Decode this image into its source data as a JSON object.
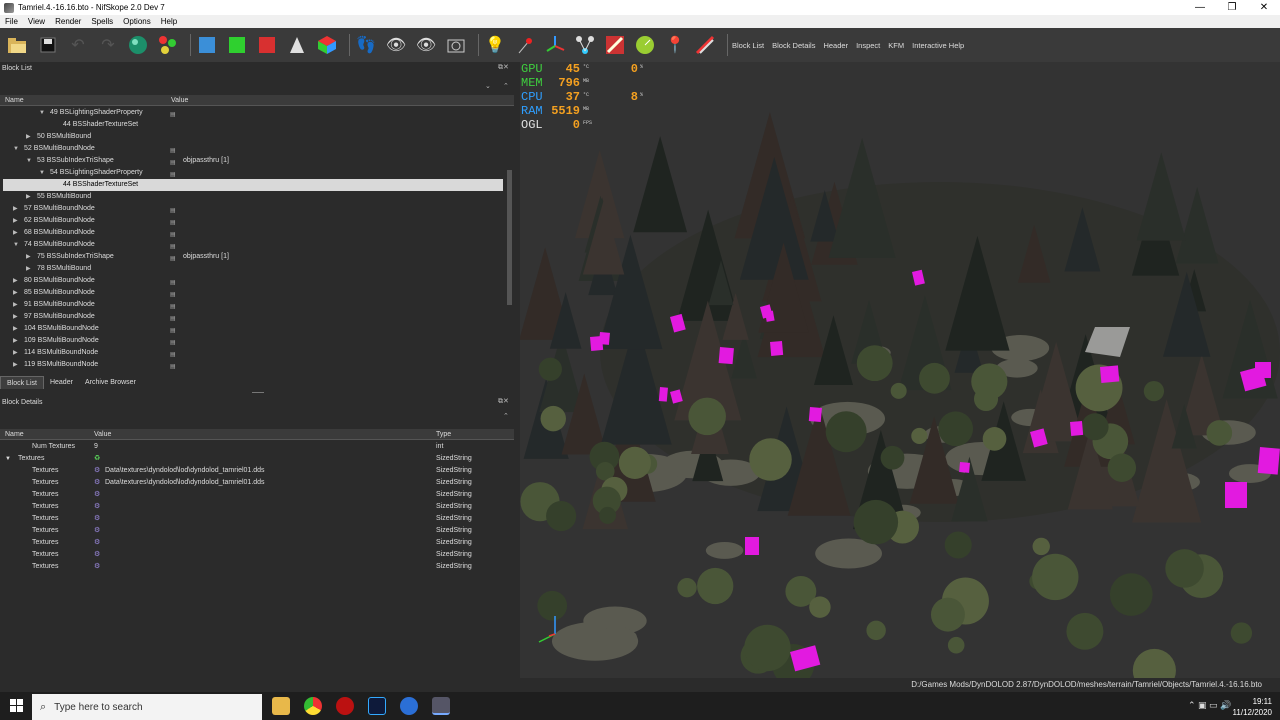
{
  "window": {
    "title": "Tamriel.4.-16.16.bto - NifSkope 2.0 Dev 7",
    "minimize": "—",
    "restore": "❐",
    "close": "✕"
  },
  "menu": [
    "File",
    "View",
    "Render",
    "Spells",
    "Options",
    "Help"
  ],
  "toolbar": {
    "links": [
      "Block List",
      "Block Details",
      "Header",
      "Inspect",
      "KFM",
      "Interactive Help"
    ]
  },
  "block_list": {
    "title": "Block List",
    "col_name": "Name",
    "col_value": "Value",
    "rows": [
      {
        "label": "49 BSLightingShaderProperty",
        "value": "",
        "indent": 3,
        "arrow": "▼",
        "icon": true
      },
      {
        "label": "44 BSShaderTextureSet",
        "value": "",
        "indent": 4,
        "arrow": "",
        "icon": false
      },
      {
        "label": "50 BSMultiBound",
        "value": "",
        "indent": 2,
        "arrow": "▶",
        "icon": false
      },
      {
        "label": "52 BSMultiBoundNode",
        "value": "",
        "indent": 1,
        "arrow": "▼",
        "icon": true
      },
      {
        "label": "53 BSSubIndexTriShape",
        "value": "objpassthru [1]",
        "indent": 2,
        "arrow": "▼",
        "icon": true
      },
      {
        "label": "54 BSLightingShaderProperty",
        "value": "",
        "indent": 3,
        "arrow": "▼",
        "icon": true
      },
      {
        "label": "44 BSShaderTextureSet",
        "value": "",
        "indent": 4,
        "arrow": "",
        "icon": false,
        "selected": true
      },
      {
        "label": "55 BSMultiBound",
        "value": "",
        "indent": 2,
        "arrow": "▶",
        "icon": false
      },
      {
        "label": "57 BSMultiBoundNode",
        "value": "",
        "indent": 1,
        "arrow": "▶",
        "icon": true
      },
      {
        "label": "62 BSMultiBoundNode",
        "value": "",
        "indent": 1,
        "arrow": "▶",
        "icon": true
      },
      {
        "label": "68 BSMultiBoundNode",
        "value": "",
        "indent": 1,
        "arrow": "▶",
        "icon": true
      },
      {
        "label": "74 BSMultiBoundNode",
        "value": "",
        "indent": 1,
        "arrow": "▼",
        "icon": true
      },
      {
        "label": "75 BSSubIndexTriShape",
        "value": "objpassthru [1]",
        "indent": 2,
        "arrow": "▶",
        "icon": true
      },
      {
        "label": "78 BSMultiBound",
        "value": "",
        "indent": 2,
        "arrow": "▶",
        "icon": false
      },
      {
        "label": "80 BSMultiBoundNode",
        "value": "",
        "indent": 1,
        "arrow": "▶",
        "icon": true
      },
      {
        "label": "85 BSMultiBoundNode",
        "value": "",
        "indent": 1,
        "arrow": "▶",
        "icon": true
      },
      {
        "label": "91 BSMultiBoundNode",
        "value": "",
        "indent": 1,
        "arrow": "▶",
        "icon": true
      },
      {
        "label": "97 BSMultiBoundNode",
        "value": "",
        "indent": 1,
        "arrow": "▶",
        "icon": true
      },
      {
        "label": "104 BSMultiBoundNode",
        "value": "",
        "indent": 1,
        "arrow": "▶",
        "icon": true
      },
      {
        "label": "109 BSMultiBoundNode",
        "value": "",
        "indent": 1,
        "arrow": "▶",
        "icon": true
      },
      {
        "label": "114 BSMultiBoundNode",
        "value": "",
        "indent": 1,
        "arrow": "▶",
        "icon": true
      },
      {
        "label": "119 BSMultiBoundNode",
        "value": "",
        "indent": 1,
        "arrow": "▶",
        "icon": true
      }
    ],
    "tabs": [
      "Block List",
      "Header",
      "Archive Browser"
    ]
  },
  "block_details": {
    "title": "Block Details",
    "col_name": "Name",
    "col_value": "Value",
    "col_type": "Type",
    "rows": [
      {
        "name": "Num Textures",
        "value": "9",
        "type": "int",
        "indent": 1,
        "arrow": "",
        "icon": ""
      },
      {
        "name": "Textures",
        "value": "",
        "type": "SizedString",
        "indent": 0,
        "arrow": "▼",
        "icon": "recycle"
      },
      {
        "name": "Textures",
        "value": "Data\\textures\\dyndolod\\lod\\dyndolod_tamriel01.dds",
        "type": "SizedString",
        "indent": 1,
        "arrow": "",
        "icon": "gear"
      },
      {
        "name": "Textures",
        "value": "Data\\textures\\dyndolod\\lod\\dyndolod_tamriel01.dds",
        "type": "SizedString",
        "indent": 1,
        "arrow": "",
        "icon": "gear"
      },
      {
        "name": "Textures",
        "value": "",
        "type": "SizedString",
        "indent": 1,
        "arrow": "",
        "icon": "gear"
      },
      {
        "name": "Textures",
        "value": "",
        "type": "SizedString",
        "indent": 1,
        "arrow": "",
        "icon": "gear"
      },
      {
        "name": "Textures",
        "value": "",
        "type": "SizedString",
        "indent": 1,
        "arrow": "",
        "icon": "gear"
      },
      {
        "name": "Textures",
        "value": "",
        "type": "SizedString",
        "indent": 1,
        "arrow": "",
        "icon": "gear"
      },
      {
        "name": "Textures",
        "value": "",
        "type": "SizedString",
        "indent": 1,
        "arrow": "",
        "icon": "gear"
      },
      {
        "name": "Textures",
        "value": "",
        "type": "SizedString",
        "indent": 1,
        "arrow": "",
        "icon": "gear"
      },
      {
        "name": "Textures",
        "value": "",
        "type": "SizedString",
        "indent": 1,
        "arrow": "",
        "icon": "gear"
      }
    ]
  },
  "hud": [
    {
      "label": "GPU",
      "color": "#3fcf3f",
      "value": "45",
      "unit": "°C",
      "extra": "0",
      "extra_unit": "%"
    },
    {
      "label": "MEM",
      "color": "#3fcf3f",
      "value": "796",
      "unit": "MB",
      "extra": "",
      "extra_unit": ""
    },
    {
      "label": "CPU",
      "color": "#2f9fff",
      "value": "37",
      "unit": "°C",
      "extra": "8",
      "extra_unit": "%"
    },
    {
      "label": "RAM",
      "color": "#2f9fff",
      "value": "5519",
      "unit": "MB",
      "extra": "",
      "extra_unit": ""
    },
    {
      "label": "OGL",
      "color": "#e0e0e0",
      "value": "0",
      "unit": "FPS",
      "extra": "",
      "extra_unit": ""
    }
  ],
  "status": {
    "path": "D:/Games Mods/DynDOLOD 2.87/DynDOLOD/meshes/terrain/Tamriel/Objects/Tamriel.4.-16.16.bto"
  },
  "taskbar": {
    "search_placeholder": "Type here to search",
    "time": "19:11",
    "date": "11/12/2020"
  }
}
